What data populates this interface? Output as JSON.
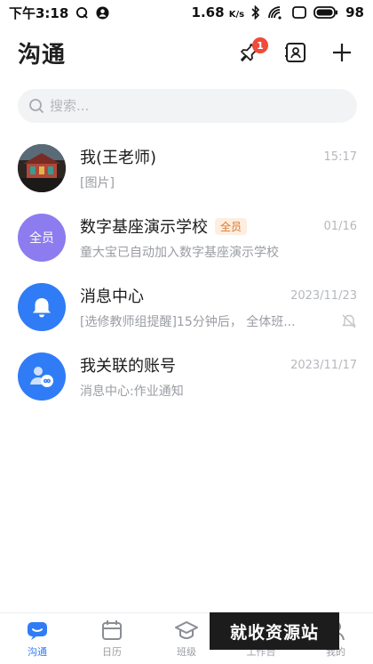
{
  "status_bar": {
    "time": "下午3:18",
    "speed": "1.68",
    "speed_unit": "K/s",
    "battery": "98"
  },
  "header": {
    "title": "沟通",
    "pin_badge": "1"
  },
  "search": {
    "placeholder": "搜索..."
  },
  "chats": [
    {
      "name": "我(王老师)",
      "tag": "",
      "time": "15:17",
      "preview": "[图片]"
    },
    {
      "name": "数字基座演示学校",
      "tag": "全员",
      "avatar_text": "全员",
      "time": "01/16",
      "preview": "童大宝已自动加入数字基座演示学校"
    },
    {
      "name": "消息中心",
      "tag": "",
      "time": "2023/11/23",
      "preview": "[选修教师组提醒]15分钟后， 全体班..."
    },
    {
      "name": "我关联的账号",
      "tag": "",
      "time": "2023/11/17",
      "preview": "消息中心:作业通知"
    }
  ],
  "bottom_nav": [
    {
      "label": "沟通",
      "icon": "chat-icon"
    },
    {
      "label": "日历",
      "icon": "calendar-icon"
    },
    {
      "label": "班级",
      "icon": "graduation-cap-icon"
    },
    {
      "label": "工作台",
      "icon": "workbench-icon"
    },
    {
      "label": "我的",
      "icon": "user-icon"
    }
  ],
  "watermark": "就收资源站",
  "colors": {
    "accent": "#2f7cf6",
    "badge": "#f04a3a",
    "group_avatar": "#8c7cf0",
    "tag_text": "#d9772b"
  }
}
